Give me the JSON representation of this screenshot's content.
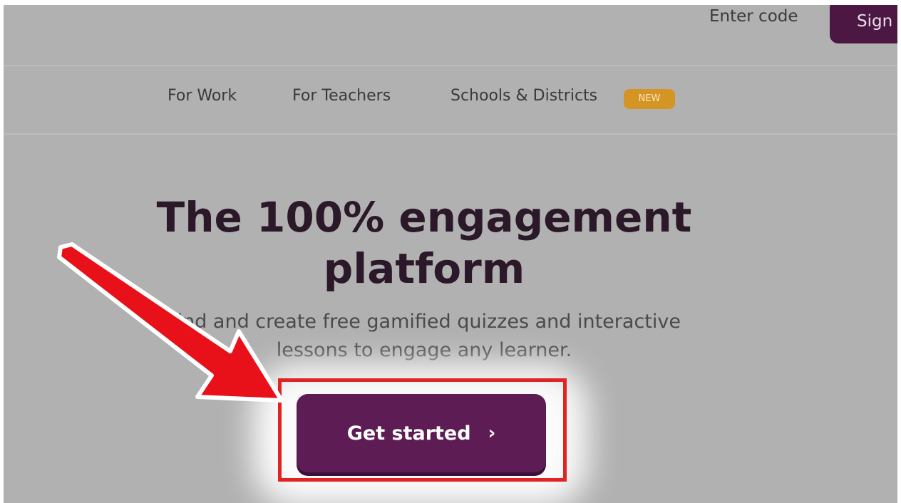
{
  "header": {
    "enter_code_label": "Enter code",
    "sign_label": "Sign"
  },
  "nav": {
    "items": [
      {
        "label": "For Work"
      },
      {
        "label": "For Teachers"
      },
      {
        "label": "Schools & Districts"
      }
    ],
    "new_badge": "NEW"
  },
  "hero": {
    "title_line1": "The 100% engagement",
    "title_line2": "platform",
    "subtitle_line1": "Find and create free gamified quizzes and interactive",
    "subtitle_line2": "lessons to engage any learner.",
    "cta_label": "Get started",
    "cta_icon": "chevron-right-icon"
  },
  "annotation": {
    "arrow_color": "#e8111a",
    "highlight_color": "#e02424"
  },
  "colors": {
    "brand_purple": "#5e1c55",
    "badge_orange": "#d49524",
    "background": "#b1b1b1"
  }
}
